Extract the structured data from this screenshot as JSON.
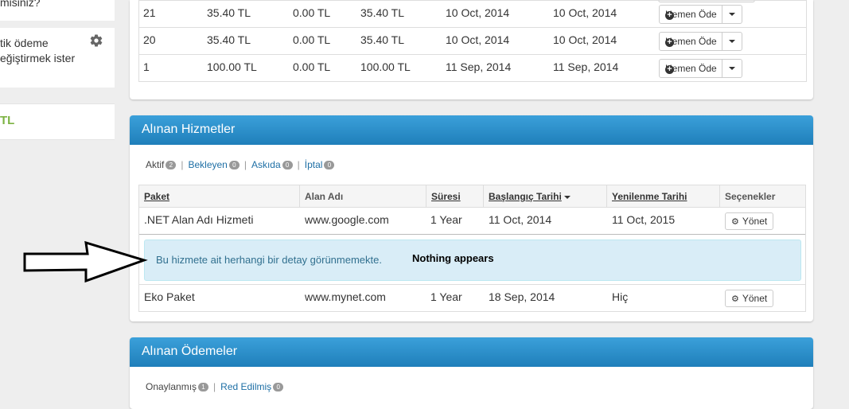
{
  "sidebar": {
    "question_text": "misiniz?",
    "auto_pay_line1": "tik ödeme",
    "auto_pay_line2": "eğiştirmek ister",
    "balance_text": "TL"
  },
  "invoices": {
    "rows": [
      {
        "id": "21",
        "amount": "35.40 TL",
        "paid": "0.00 TL",
        "total": "35.40 TL",
        "date": "10 Oct, 2014",
        "due": "10 Oct, 2014",
        "action": "Hemen Öde"
      },
      {
        "id": "20",
        "amount": "35.40 TL",
        "paid": "0.00 TL",
        "total": "35.40 TL",
        "date": "10 Oct, 2014",
        "due": "10 Oct, 2014",
        "action": "Hemen Öde"
      },
      {
        "id": "1",
        "amount": "100.00 TL",
        "paid": "0.00 TL",
        "total": "100.00 TL",
        "date": "11 Sep, 2014",
        "due": "11 Sep, 2014",
        "action": "Hemen Öde"
      }
    ]
  },
  "services": {
    "title": "Alınan Hizmetler",
    "filters": [
      {
        "label": "Aktif",
        "count": "2"
      },
      {
        "label": "Bekleyen",
        "count": "0"
      },
      {
        "label": "Askıda",
        "count": "0"
      },
      {
        "label": "İptal",
        "count": "0"
      }
    ],
    "columns": {
      "package": "Paket",
      "domain": "Alan Adı",
      "period": "Süresi",
      "start": "Başlangıç Tarihi",
      "renewal": "Yenilenme Tarihi",
      "options": "Seçenekler"
    },
    "rows": [
      {
        "package": ".NET Alan Adı Hizmeti",
        "domain": "www.google.com",
        "period": "1 Year",
        "start": "11 Oct, 2014",
        "renewal": "11 Oct, 2015",
        "action": "Yönet"
      },
      {
        "package": "Eko Paket",
        "domain": "www.mynet.com",
        "period": "1 Year",
        "start": "18 Sep, 2014",
        "renewal": "Hiç",
        "action": "Yönet"
      }
    ],
    "detail_message": "Bu hizmete ait herhangi bir detay görünmemekte.",
    "annotation": "Nothing appears"
  },
  "payments": {
    "title": "Alınan Ödemeler",
    "filters": [
      {
        "label": "Onaylanmış",
        "count": "1"
      },
      {
        "label": "Red Edilmiş",
        "count": "0"
      }
    ]
  },
  "colors": {
    "header_blue": "#2a8fcc",
    "link_blue": "#1e6fa5",
    "balance_green": "#7cb342",
    "alert_bg": "#d9edf7"
  }
}
